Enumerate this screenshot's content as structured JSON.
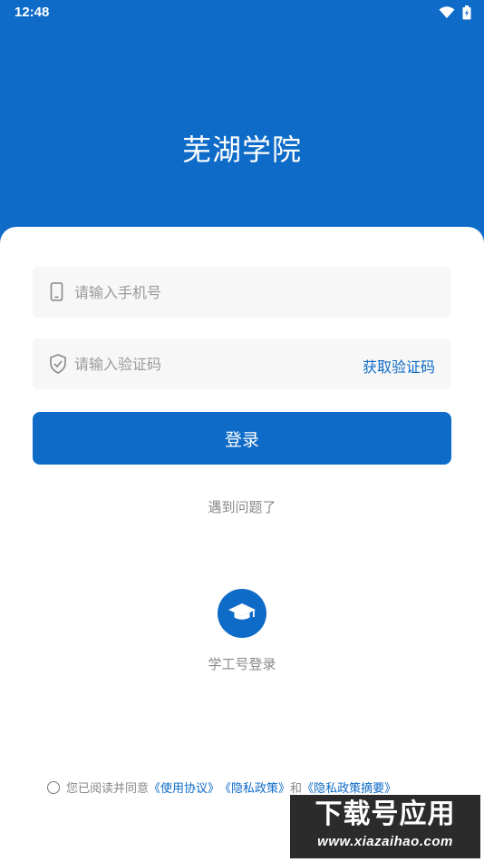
{
  "status_bar": {
    "time": "12:48"
  },
  "app": {
    "title": "芜湖学院"
  },
  "login": {
    "phone_placeholder": "请输入手机号",
    "code_placeholder": "请输入验证码",
    "get_code_label": "获取验证码",
    "submit_label": "登录",
    "problem_label": "遇到问题了"
  },
  "staff_login": {
    "label": "学工号登录",
    "icon": "graduation-cap-icon"
  },
  "agreement": {
    "prefix": "您已阅读并同意",
    "terms": "《使用协议》",
    "privacy": "《隐私政策》",
    "conjunction": "和",
    "privacy_summary": "《隐私政策摘要》"
  },
  "watermark": {
    "main": "下载号应用",
    "url": "www.xiazaihao.com"
  },
  "colors": {
    "brand": "#0e6bc7",
    "field_bg": "#f7f7f7",
    "muted_text": "#888888"
  }
}
